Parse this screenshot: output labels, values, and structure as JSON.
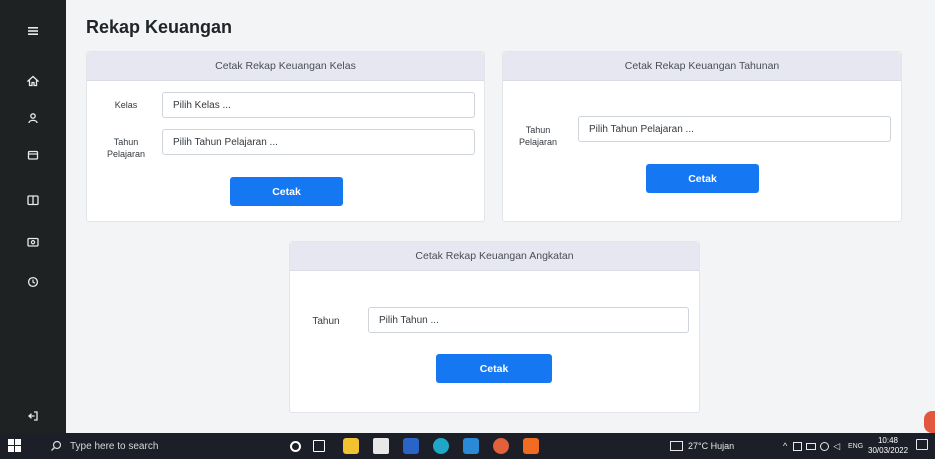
{
  "page": {
    "title": "Rekap Keuangan"
  },
  "sidebar": {
    "icons": [
      "menu-icon",
      "home-icon",
      "user-icon",
      "wallet-icon",
      "book-icon",
      "money-icon",
      "history-icon",
      "logout-icon"
    ]
  },
  "card_kelas": {
    "header": "Cetak Rekap Keuangan Kelas",
    "kelas_label": "Kelas",
    "kelas_placeholder": "Pilih Kelas ...",
    "tahun_label_line1": "Tahun",
    "tahun_label_line2": "Pelajaran",
    "tahun_placeholder": "Pilih Tahun Pelajaran ...",
    "button": "Cetak"
  },
  "card_tahunan": {
    "header": "Cetak Rekap Keuangan Tahunan",
    "tahun_label_line1": "Tahun",
    "tahun_label_line2": "Pelajaran",
    "tahun_placeholder": "Pilih Tahun Pelajaran ...",
    "button": "Cetak"
  },
  "card_angkatan": {
    "header": "Cetak Rekap Keuangan Angkatan",
    "tahun_label": "Tahun",
    "tahun_placeholder": "Pilih Tahun ...",
    "button": "Cetak"
  },
  "taskbar": {
    "search_placeholder": "Type here to search",
    "weather": "27°C  Hujan",
    "language": "ENG",
    "time": "10:48",
    "date": "30/03/2022"
  },
  "colors": {
    "sidebar_bg": "#1f2223",
    "primary_button": "#1677f3",
    "card_header_bg": "#e6e7f0",
    "taskbar_bg": "#1c1f28"
  }
}
